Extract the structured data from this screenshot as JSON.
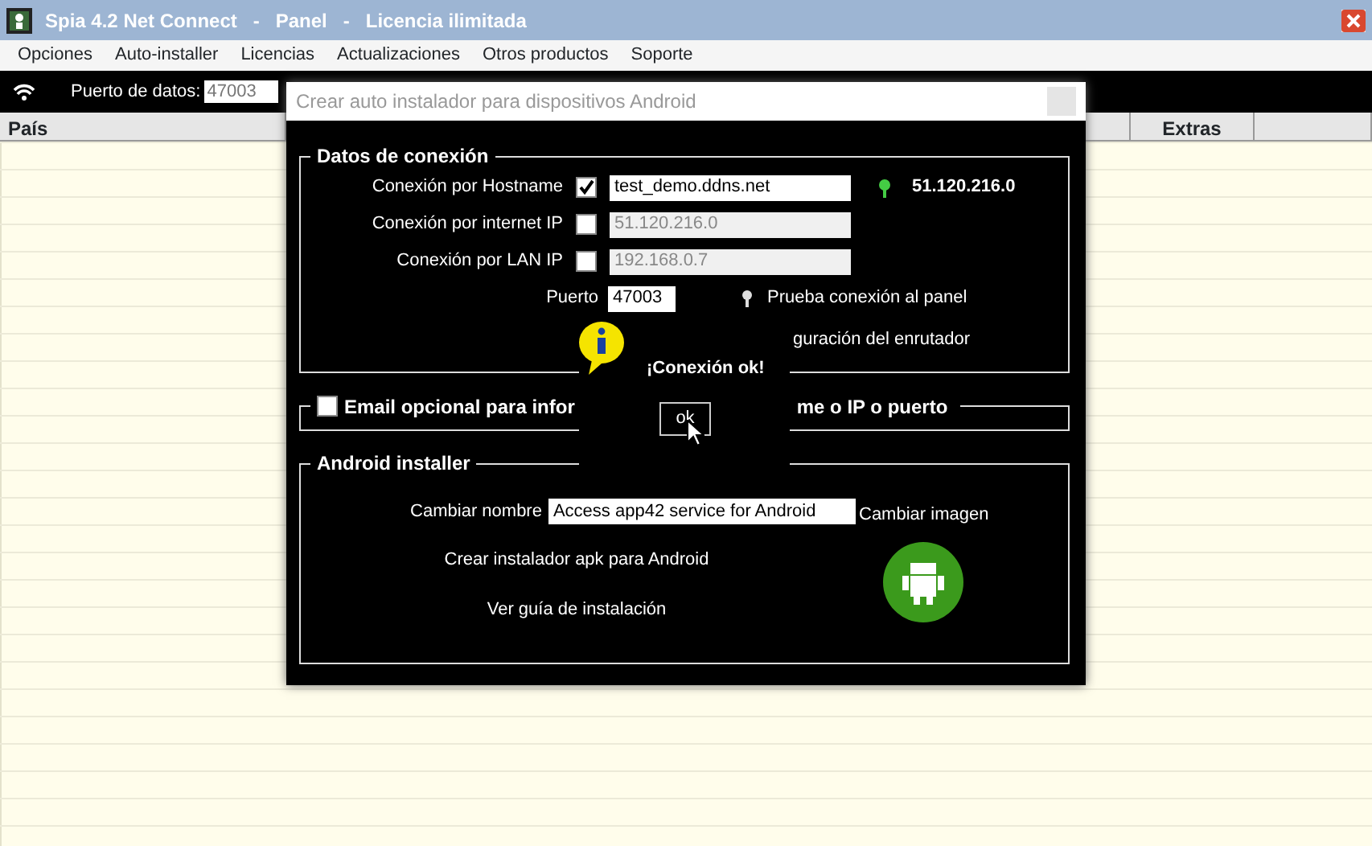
{
  "window": {
    "title": "Spia 4.2 Net Connect   -   Panel   -   Licencia ilimitada"
  },
  "menu": [
    "Opciones",
    "Auto-installer",
    "Licencias",
    "Actualizaciones",
    "Otros productos",
    "Soporte"
  ],
  "toolbar": {
    "port_label": "Puerto de datos:",
    "port_value": "47003"
  },
  "table": {
    "columns": [
      {
        "label": "País"
      },
      {
        "label": "Extras"
      }
    ]
  },
  "dialog": {
    "title": "Crear auto instalador para dispositivos Android",
    "connection": {
      "legend": "Datos de conexión",
      "rows": [
        {
          "label": "Conexión por Hostname",
          "checked": true,
          "value": "test_demo.ddns.net",
          "disabled": false
        },
        {
          "label": "Conexión por internet IP",
          "checked": false,
          "value": "51.120.216.0",
          "disabled": true
        },
        {
          "label": "Conexión por LAN IP",
          "checked": false,
          "value": "192.168.0.7",
          "disabled": true
        }
      ],
      "status_ip": "51.120.216.0",
      "port_label": "Puerto",
      "port_value": "47003",
      "test_link": "Prueba conexión al panel",
      "router_link": "guración del enrutador"
    },
    "email": {
      "checked": false,
      "legend_left": "Email opcional para infor",
      "legend_right": "me o IP o puerto"
    },
    "installer": {
      "legend": "Android installer",
      "name_label": "Cambiar nombre",
      "name_value": "Access app42 service for Android",
      "image_link": "Cambiar imagen",
      "create_link": "Crear instalador apk para Android",
      "guide_link": "Ver guía de instalación"
    }
  },
  "message": {
    "text": "¡Conexión ok!",
    "button": "ok"
  }
}
